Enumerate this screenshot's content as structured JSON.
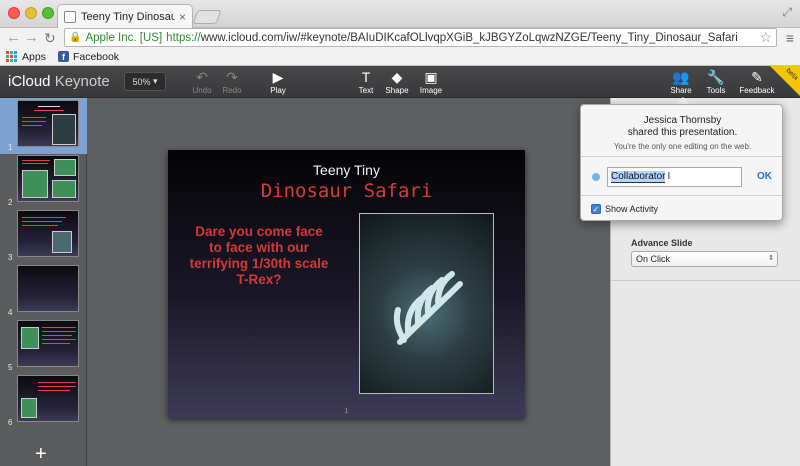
{
  "browser": {
    "tab_title": "Teeny Tiny Dinosaur Safari",
    "tab_close": "×",
    "ev_label": "Apple Inc. [US]",
    "url_scheme": "https://",
    "url_rest": "www.icloud.com/iw/#keynote/BAIuDIKcafOLlvqpXGiB_kJBGYZoLqwzNZGE/Teeny_Tiny_Dinosaur_Safari",
    "bookmarks": [
      "Apps",
      "Facebook"
    ]
  },
  "app": {
    "brand_bold": "iCloud",
    "brand_light": "Keynote",
    "zoom": "50%",
    "toolbar": {
      "undo": "Undo",
      "redo": "Redo",
      "play": "Play",
      "text": "Text",
      "shape": "Shape",
      "image": "Image",
      "share": "Share",
      "tools": "Tools",
      "feedback": "Feedback",
      "beta": "beta"
    }
  },
  "navigator": {
    "slides": [
      "1",
      "2",
      "3",
      "4",
      "5",
      "6"
    ],
    "selected": "1",
    "add_label": "+"
  },
  "slide": {
    "title_line1": "Teeny Tiny",
    "title_line2": "Dinosaur Safari",
    "body": "Dare you come face to face with our terrifying 1/30th scale T-Rex?",
    "page_number": "1"
  },
  "inspector": {
    "advance_label": "Advance Slide",
    "advance_value": "On Click"
  },
  "share_popover": {
    "name": "Jessica Thornsby",
    "shared_text": "shared this presentation.",
    "note": "You're the only one editing on the web.",
    "role_value": "Collaborator",
    "ok_label": "OK",
    "show_activity_label": "Show Activity",
    "show_activity_checked": true
  },
  "colors": {
    "accent": "#5fd0a8",
    "slide_red": "#d53b3b",
    "link_blue": "#2a6fd6"
  }
}
